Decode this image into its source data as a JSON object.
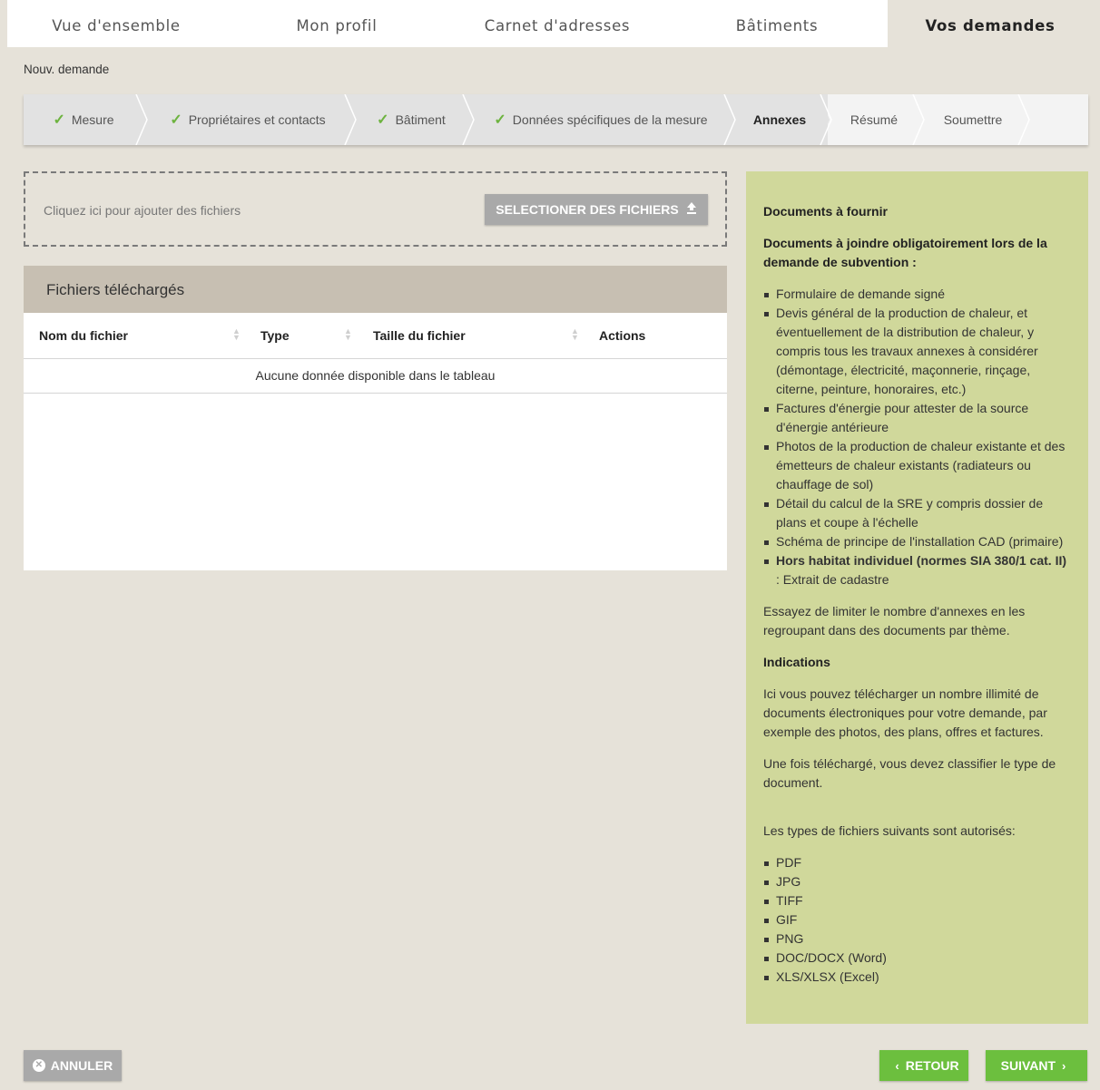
{
  "topnav": {
    "tabs": [
      "Vue d'ensemble",
      "Mon profil",
      "Carnet d'adresses",
      "Bâtiments",
      "Vos demandes"
    ],
    "active_index": 4
  },
  "breadcrumb": "Nouv. demande",
  "wizard": {
    "steps": [
      {
        "label": "Mesure",
        "state": "done"
      },
      {
        "label": "Propriétaires et contacts",
        "state": "done"
      },
      {
        "label": "Bâtiment",
        "state": "done"
      },
      {
        "label": "Données spécifiques de la mesure",
        "state": "done"
      },
      {
        "label": "Annexes",
        "state": "active"
      },
      {
        "label": "Résumé",
        "state": "todo"
      },
      {
        "label": "Soumettre",
        "state": "todo"
      }
    ]
  },
  "upload": {
    "hint": "Cliquez ici pour ajouter des fichiers",
    "button_label": "SELECTIONER DES FICHIERS"
  },
  "files": {
    "title": "Fichiers téléchargés",
    "columns": [
      "Nom du fichier",
      "Type",
      "Taille du fichier",
      "Actions"
    ],
    "empty_message": "Aucune donnée disponible dans le tableau"
  },
  "info": {
    "heading": "Documents à fournir",
    "intro": "Documents à joindre obligatoirement lors de la demande de subvention :",
    "documents": [
      "Formulaire de demande signé",
      "Devis général de la production de chaleur, et éventuellement de la distribution de chaleur, y compris tous les travaux annexes à considérer (démontage, électricité, maçonnerie, rinçage, citerne, peinture, honoraires, etc.)",
      "Factures d'énergie pour attester de la source d'énergie antérieure",
      "Photos de la production de chaleur existante et des émetteurs de chaleur existants (radiateurs ou chauffage de sol)",
      "Détail du calcul de la SRE y compris dossier de plans et coupe à l'échelle",
      "Schéma de principe de l'installation CAD (primaire)"
    ],
    "last_doc_bold": "Hors habitat individuel (normes SIA 380/1 cat. II)",
    "last_doc_rest": " : Extrait de cadastre",
    "limit_note": "Essayez de limiter le nombre d'annexes en les regroupant dans des documents par thème.",
    "indications_heading": "Indications",
    "indications_text": "Ici vous pouvez télécharger un nombre illimité de documents électroniques pour votre demande, par exemple des photos, des plans, offres et factures.",
    "classify_text": "Une fois téléchargé, vous devez classifier le type de document.",
    "types_intro": "Les types de fichiers suivants sont autorisés:",
    "file_types": [
      "PDF",
      "JPG",
      "TIFF",
      "GIF",
      "PNG",
      "DOC/DOCX (Word)",
      "XLS/XLSX (Excel)"
    ]
  },
  "footer": {
    "cancel": "ANNULER",
    "back": "RETOUR",
    "next": "SUIVANT"
  },
  "colors": {
    "page_bg": "#e6e2d9",
    "green": "#6cbf3e",
    "info_bg": "#d0d89b",
    "panel_header": "#c7bfb2",
    "grey_button": "#a9a9a9"
  }
}
